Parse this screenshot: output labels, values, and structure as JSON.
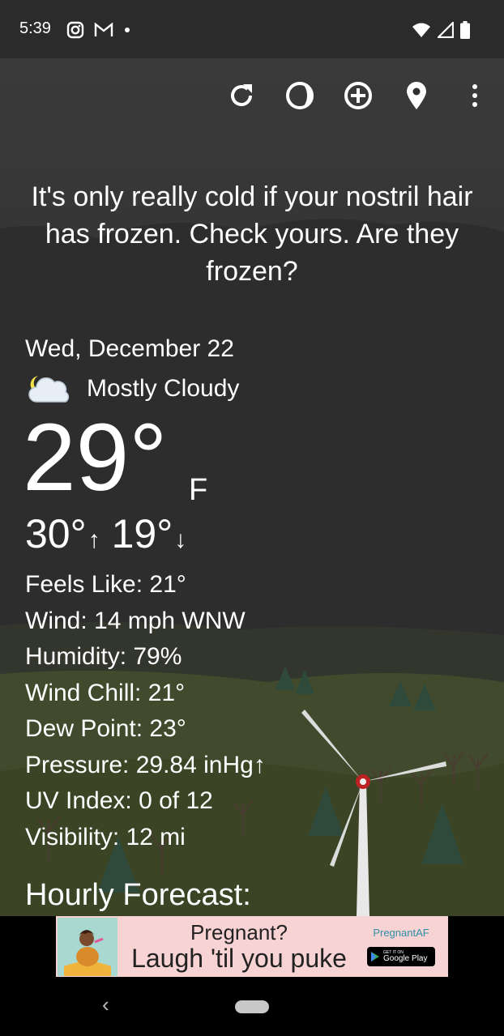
{
  "status_bar": {
    "time": "5:39",
    "icons_left": [
      "instagram-icon",
      "gmail-icon",
      "notification-dot-icon"
    ],
    "icons_right": [
      "wifi-icon",
      "cell-signal-icon",
      "battery-icon"
    ]
  },
  "toolbar": {
    "icons": [
      "refresh-icon",
      "theme-icon",
      "add-location-icon",
      "location-pin-icon",
      "more-vert-icon"
    ]
  },
  "quote": "It's only really cold if your nostril hair has frozen. Check yours. Are they frozen?",
  "weather": {
    "date": "Wed, December 22",
    "condition": "Mostly Cloudy",
    "temperature": "29°",
    "unit": "F",
    "high": "30°",
    "high_arrow": "↑",
    "low": "19°",
    "low_arrow": "↓",
    "details": [
      "Feels Like:  21°",
      "Wind:  14 mph WNW",
      "Humidity:  79%",
      "Wind Chill:  21°",
      "Dew Point:  23°",
      "Pressure:  29.84 inHg↑",
      "UV Index:  0 of 12",
      "Visibility:  12 mi"
    ]
  },
  "hourly_title": "Hourly Forecast:",
  "ad": {
    "line1": "Pregnant?",
    "line2": "Laugh 'til you puke",
    "brand": "PregnantAF",
    "badge_small": "GET IT ON",
    "badge_big": "Google Play",
    "colors": {
      "background": "#f7d3d3",
      "brand": "#2d8fa8"
    }
  },
  "nav": {
    "back": "‹"
  },
  "colors": {
    "background": "#202020",
    "status_bar": "#2b2b2b",
    "text": "#ffffff"
  }
}
